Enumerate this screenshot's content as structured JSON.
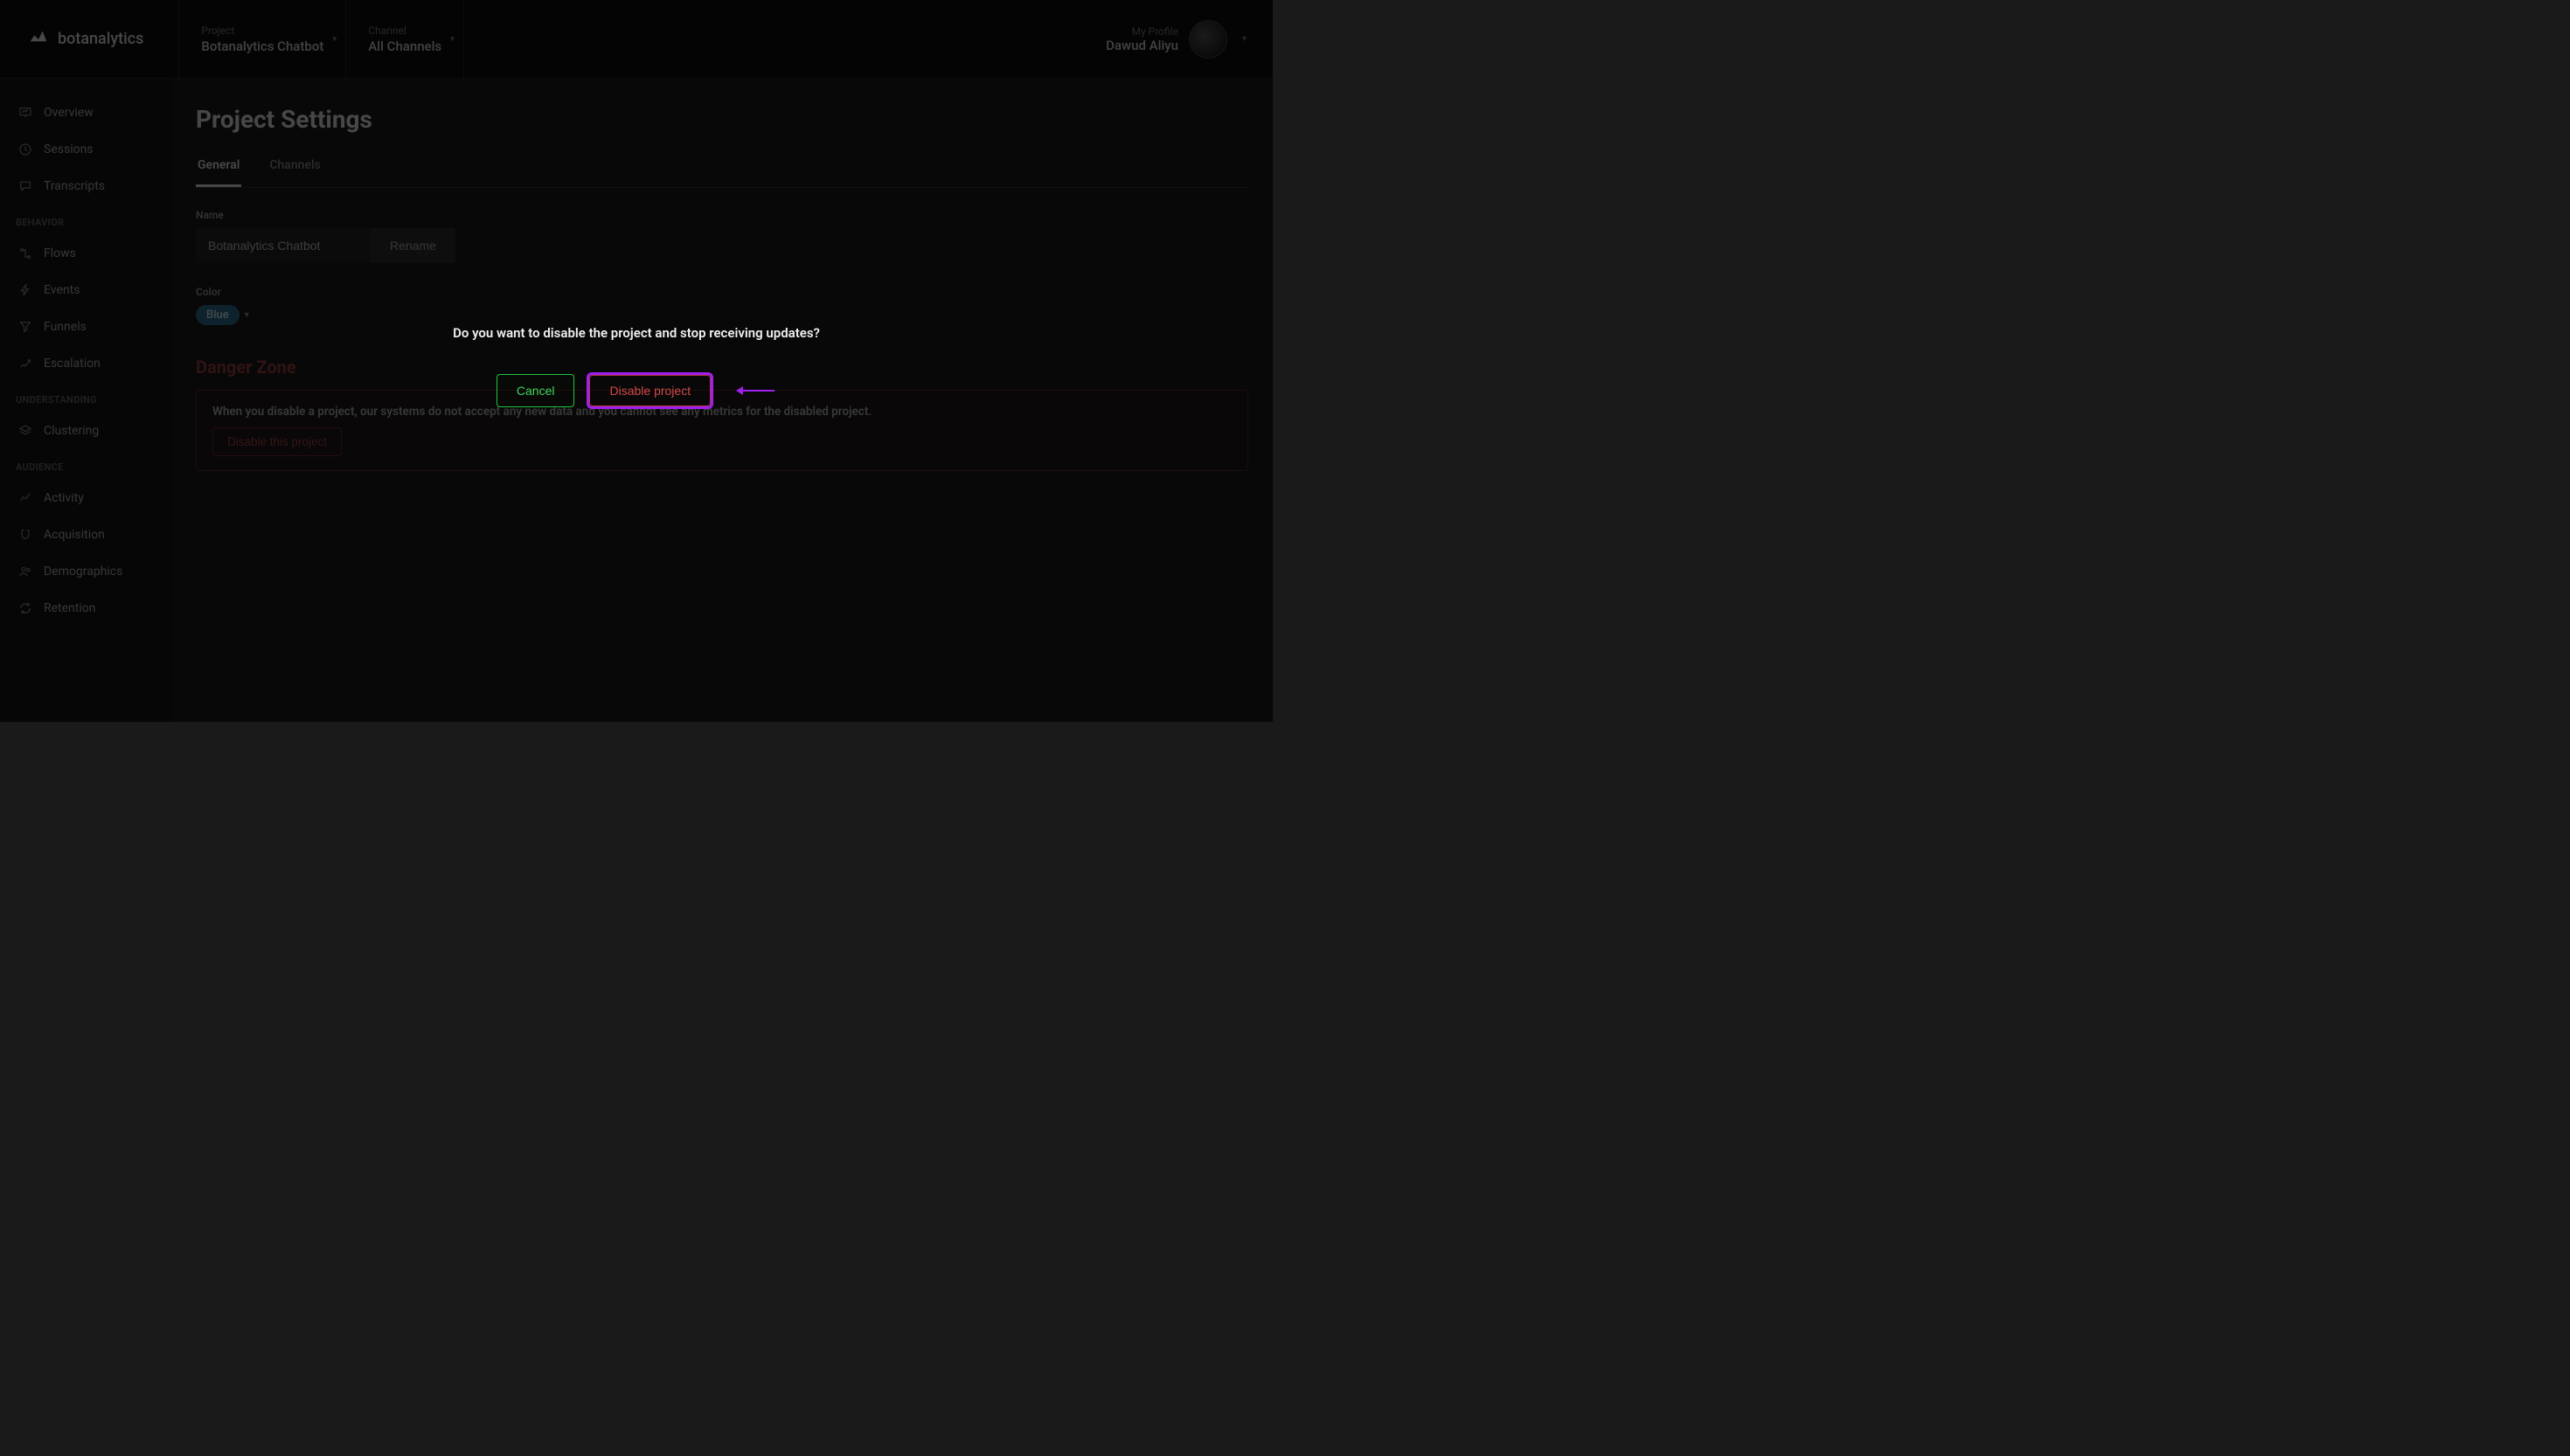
{
  "brand": "botanalytics",
  "header": {
    "project_label": "Project",
    "project_value": "Botanalytics Chatbot",
    "channel_label": "Channel",
    "channel_value": "All Channels",
    "profile_label": "My Profile",
    "profile_name": "Dawud Aliyu"
  },
  "sidebar": {
    "top": [
      {
        "label": "Overview"
      },
      {
        "label": "Sessions"
      },
      {
        "label": "Transcripts"
      }
    ],
    "behavior_heading": "BEHAVIOR",
    "behavior": [
      {
        "label": "Flows"
      },
      {
        "label": "Events"
      },
      {
        "label": "Funnels"
      },
      {
        "label": "Escalation"
      }
    ],
    "understanding_heading": "UNDERSTANDING",
    "understanding": [
      {
        "label": "Clustering"
      }
    ],
    "audience_heading": "AUDIENCE",
    "audience": [
      {
        "label": "Activity"
      },
      {
        "label": "Acquisition"
      },
      {
        "label": "Demographics"
      },
      {
        "label": "Retention"
      }
    ]
  },
  "page": {
    "title": "Project Settings",
    "tabs": {
      "general": "General",
      "channels": "Channels"
    },
    "name_label": "Name",
    "name_value": "Botanalytics Chatbot",
    "rename": "Rename",
    "color_label": "Color",
    "color_value": "Blue",
    "danger_heading": "Danger Zone",
    "danger_text": "When you disable a project, our systems do not accept any new data and you cannot see any metrics for the disabled project.",
    "disable_this": "Disable this project"
  },
  "modal": {
    "message": "Do you want to disable the project and stop receiving updates?",
    "cancel": "Cancel",
    "confirm": "Disable project"
  },
  "colors": {
    "accent_blue": "#2a6a8a",
    "danger": "#a84646",
    "annotation": "#a020f0",
    "success": "#1ec43f"
  }
}
